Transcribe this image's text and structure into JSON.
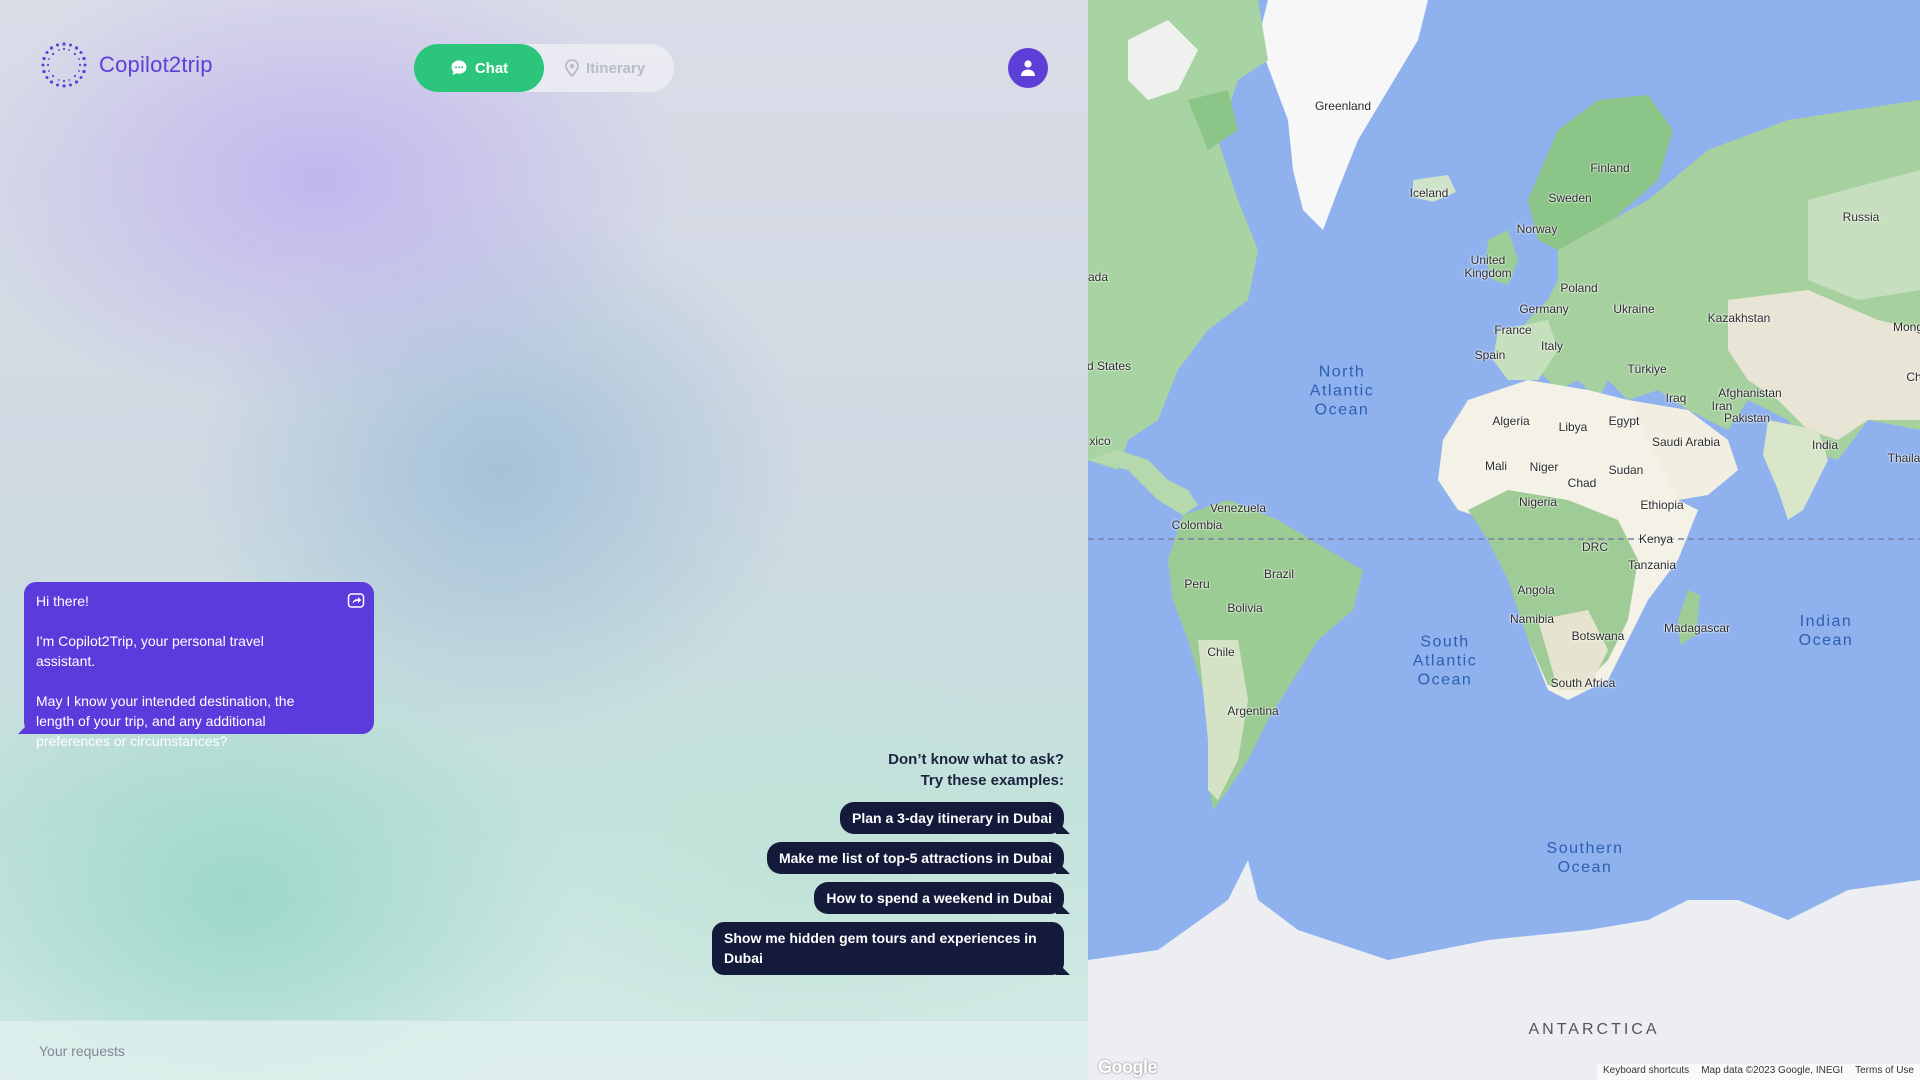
{
  "app": {
    "name": "Copilot2trip",
    "accent": "#5b3fd6",
    "chat_green": "#2bc67c"
  },
  "tabs": [
    {
      "label": "Chat",
      "icon": "chat-bubble-icon",
      "active": true
    },
    {
      "label": "Itinerary",
      "icon": "location-pin-icon",
      "active": false
    }
  ],
  "user": {
    "icon": "user-icon"
  },
  "bot_message": {
    "lines": [
      "Hi there!",
      "I'm Copilot2Trip, your personal travel assistant.",
      "May I know your intended destination, the length of your trip, and any additional preferences or circumstances?"
    ],
    "share_icon": "share-icon"
  },
  "examples": {
    "heading_line1": "Don’t know what to ask?",
    "heading_line2": "Try these examples:",
    "items": [
      "Plan a 3-day itinerary in Dubai",
      "Make me list of top-5 attractions in Dubai",
      "How to spend a weekend in Dubai",
      "Show me hidden gem tours and experiences in Dubai"
    ]
  },
  "input": {
    "placeholder": "Your requests"
  },
  "map": {
    "countries": [
      "Greenland",
      "Finland",
      "Iceland",
      "Sweden",
      "Norway",
      "Russia",
      "United Kingdom",
      "Poland",
      "Germany",
      "Ukraine",
      "Kazakhstan",
      "France",
      "Italy",
      "Spain",
      "Türkiye",
      "Afghanistan",
      "Iraq",
      "Iran",
      "Pakistan",
      "Algeria",
      "Libya",
      "Egypt",
      "Saudi Arabia",
      "India",
      "Mali",
      "Niger",
      "Chad",
      "Sudan",
      "Nigeria",
      "Ethiopia",
      "Venezuela",
      "Colombia",
      "Kenya",
      "DRC",
      "Tanzania",
      "Brazil",
      "Peru",
      "Bolivia",
      "Angola",
      "Namibia",
      "Botswana",
      "Madagascar",
      "Chile",
      "South Africa",
      "Argentina"
    ],
    "edge_labels": [
      "ada",
      "d States",
      "xico",
      "Mong",
      "Ch",
      "Thaila"
    ],
    "oceans": [
      {
        "line1": "North",
        "line2": "Atlantic",
        "line3": "Ocean"
      },
      {
        "line1": "South",
        "line2": "Atlantic",
        "line3": "Ocean"
      },
      {
        "line1": "Indian",
        "line2": "Ocean",
        "line3": ""
      },
      {
        "line1": "Southern",
        "line2": "Ocean",
        "line3": ""
      }
    ],
    "antarctica": "ANTARCTICA",
    "attribution": "Google",
    "footer": [
      "Keyboard shortcuts",
      "Map data ©2023 Google, INEGI",
      "Terms of Use"
    ]
  }
}
